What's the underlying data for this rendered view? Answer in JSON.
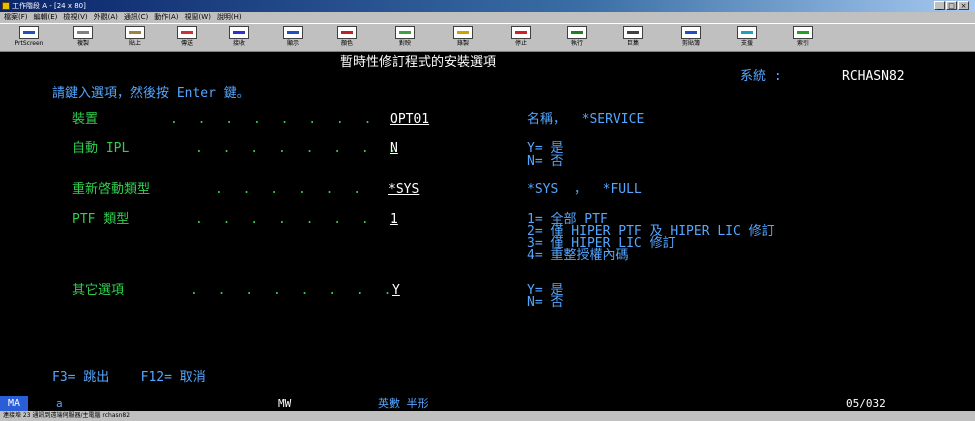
{
  "window": {
    "title": "工作階段 A - [24 x 80]",
    "min": "_",
    "max": "□",
    "close": "×"
  },
  "menu": [
    "檔案(F)",
    "編輯(E)",
    "檢視(V)",
    "外觀(A)",
    "通訊(C)",
    "動作(A)",
    "視窗(W)",
    "說明(H)"
  ],
  "toolbar": [
    "PrtScreen",
    "複製",
    "貼上",
    "傳送",
    "接收",
    "顯示",
    "顏色",
    "對映",
    "錄製",
    "停止",
    "執行",
    "巨集",
    "剪貼簿",
    "支援",
    "索引"
  ],
  "screen": {
    "title": "暫時性修訂程式的安裝選項",
    "system_label": "系統 :",
    "system_value": "RCHASN82",
    "instruction": "請鍵入選項，然後按 Enter 鍵。",
    "fields": [
      {
        "label": "裝置",
        "dots": ". . . . . . . . .",
        "value": "OPT01",
        "help": [
          "名稱，  *SERVICE"
        ]
      },
      {
        "label": "自動 IPL",
        "dots": ". . . . . . . .",
        "value": "N",
        "help": [
          "Y= 是",
          "N= 否"
        ]
      },
      {
        "label": "重新啓動類型",
        "dots": ". . . . . .",
        "value": "*SYS",
        "help": [
          "*SYS  ，  *FULL"
        ]
      },
      {
        "label": "PTF 類型",
        "dots": ". . . . . . . .",
        "value": "1",
        "help": [
          "1= 全部 PTF",
          "2= 僅 HIPER PTF 及 HIPER LIC 修訂",
          "3= 僅 HIPER LIC 修訂",
          "4= 重整授權內碼"
        ]
      },
      {
        "label": "其它選項",
        "dots": ". . . . . . . .",
        "value": "Y",
        "help": [
          "Y= 是",
          "N= 否"
        ]
      }
    ],
    "fkeys": "F3= 跳出    F12= 取消"
  },
  "status": {
    "mode": "MA",
    "a": "a",
    "mw": "MW",
    "input_mode": "英數 半形",
    "cursor": "05/032"
  },
  "bottom_text": "連接埠 23 通訊到遠端伺服器/主電腦 rchasn82",
  "colors": {
    "screen_bg": "#000000",
    "green": "#30d050",
    "white": "#ffffff",
    "blue": "#55a6ff",
    "mode_box": "#2a5dd8"
  }
}
